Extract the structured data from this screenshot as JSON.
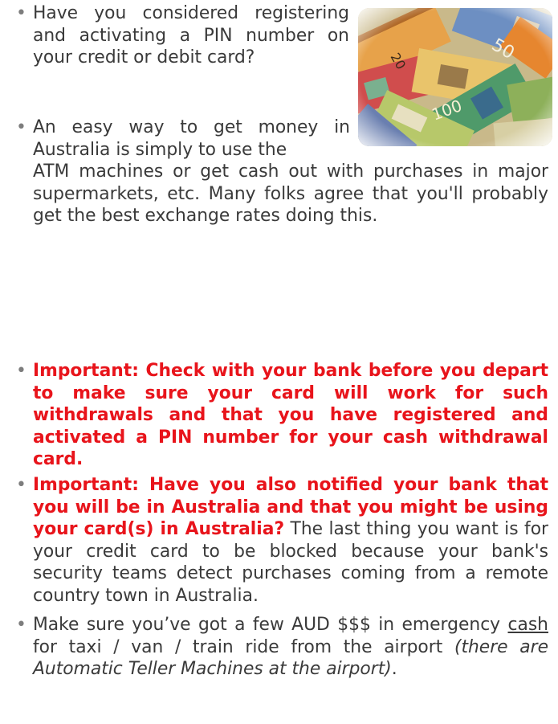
{
  "bullets": {
    "b1": "Have you considered registering and activating a PIN number on your credit or debit card?",
    "b2": "An easy way to get money in Australia is simply to use the ATM machines or get cash out with purchases in major supermarkets, etc.  Many folks agree that you'll probably get the best exchange rates doing this.",
    "b3": "Important: Check with your bank before you depart to make sure your card will work for such withdrawals and that you have registered and activated a PIN number for your cash withdrawal card.",
    "b4_bold": "Important: Have you also notified your bank that you will be in Australia and that you might be using your card(s) in Australia?",
    "b4_rest": " The last thing you want is for your credit card to be blocked because your bank's security teams detect purchases coming from a remote country town in Australia.",
    "b5_pre": "Make sure you’ve got a few AUD $$$ in emergency ",
    "b5_cash": "cash",
    "b5_mid": " for taxi / van / train ride from the airport ",
    "b5_italic": "(there are Automatic Teller Machines at the airport)",
    "b5_end": "."
  },
  "image": {
    "subject": "australian-banknotes"
  },
  "colors": {
    "text": "#3a3a3a",
    "important": "#e8141b",
    "bullet": "#7d7d7d"
  }
}
